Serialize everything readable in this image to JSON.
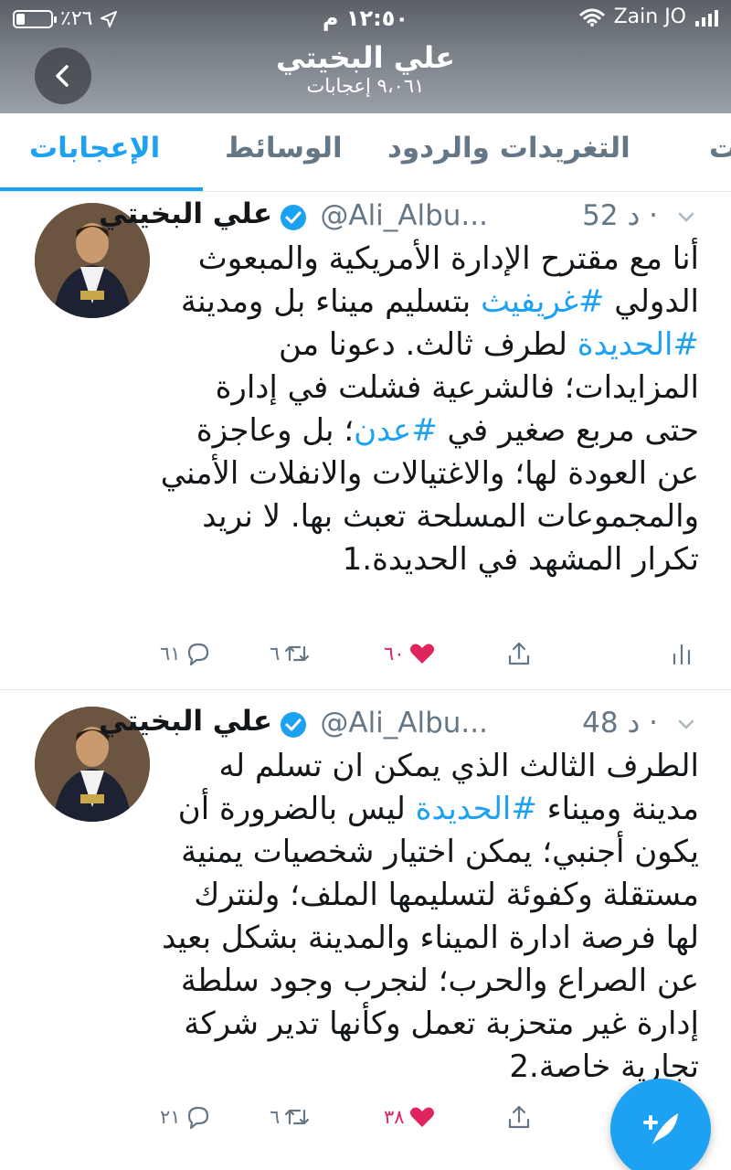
{
  "status_bar": {
    "battery": "٪٢٦",
    "battery_level": 0.26,
    "time": "١٢:٥٠ م",
    "carrier": "Zain JO"
  },
  "header": {
    "name": "علي البخيتي",
    "likes_count": "٩،٠٦١ إعجابات"
  },
  "tabs": {
    "likes": "الإعجابات",
    "media": "الوسائط",
    "replies": "التغريدات والردود",
    "tweets": "ت"
  },
  "tweets": [
    {
      "display_name": "علي البخيتي",
      "handle": "@Ali_Albu...",
      "time": "52 د ·",
      "text_parts": [
        "أنا مع مقترح الإدارة الأمريكية والمبعوث الدولي ",
        "#غريفيث",
        " بتسليم ميناء بل ومدينة ",
        "#الحديدة",
        " لطرف ثالث. دعونا من المزايدات؛ فالشرعية فشلت في إدارة حتى مربع صغير في ",
        "#عدن",
        "؛ بل وعاجزة عن العودة لها؛ والاغتيالات والانفلات الأمني والمجموعات المسلحة تعبث بها. لا نريد تكرار المشهد في الحديدة.1"
      ],
      "replies": "٦١",
      "retweets": "٦",
      "likes": "٦٠"
    },
    {
      "display_name": "علي البخيتي",
      "handle": "@Ali_Albu...",
      "time": "48 د ·",
      "text_parts": [
        "الطرف الثالث الذي يمكن ان تسلم له مدينة وميناء ",
        "#الحديدة",
        " ليس بالضرورة أن يكون أجنبي؛ يمكن اختيار شخصيات يمنية مستقلة وكفوئة لتسليمها الملف؛ ولنترك لها فرصة ادارة الميناء والمدينة بشكل بعيد عن الصراع والحرب؛ لنجرب وجود سلطة إدارة غير متحزبة تعمل وكأنها تدير شركة تجارية خاصة.2"
      ],
      "replies": "٢١",
      "retweets": "٦",
      "likes": "٣٨"
    }
  ],
  "colors": {
    "accent": "#1da1f2",
    "like": "#e0245e",
    "muted": "#657786"
  }
}
